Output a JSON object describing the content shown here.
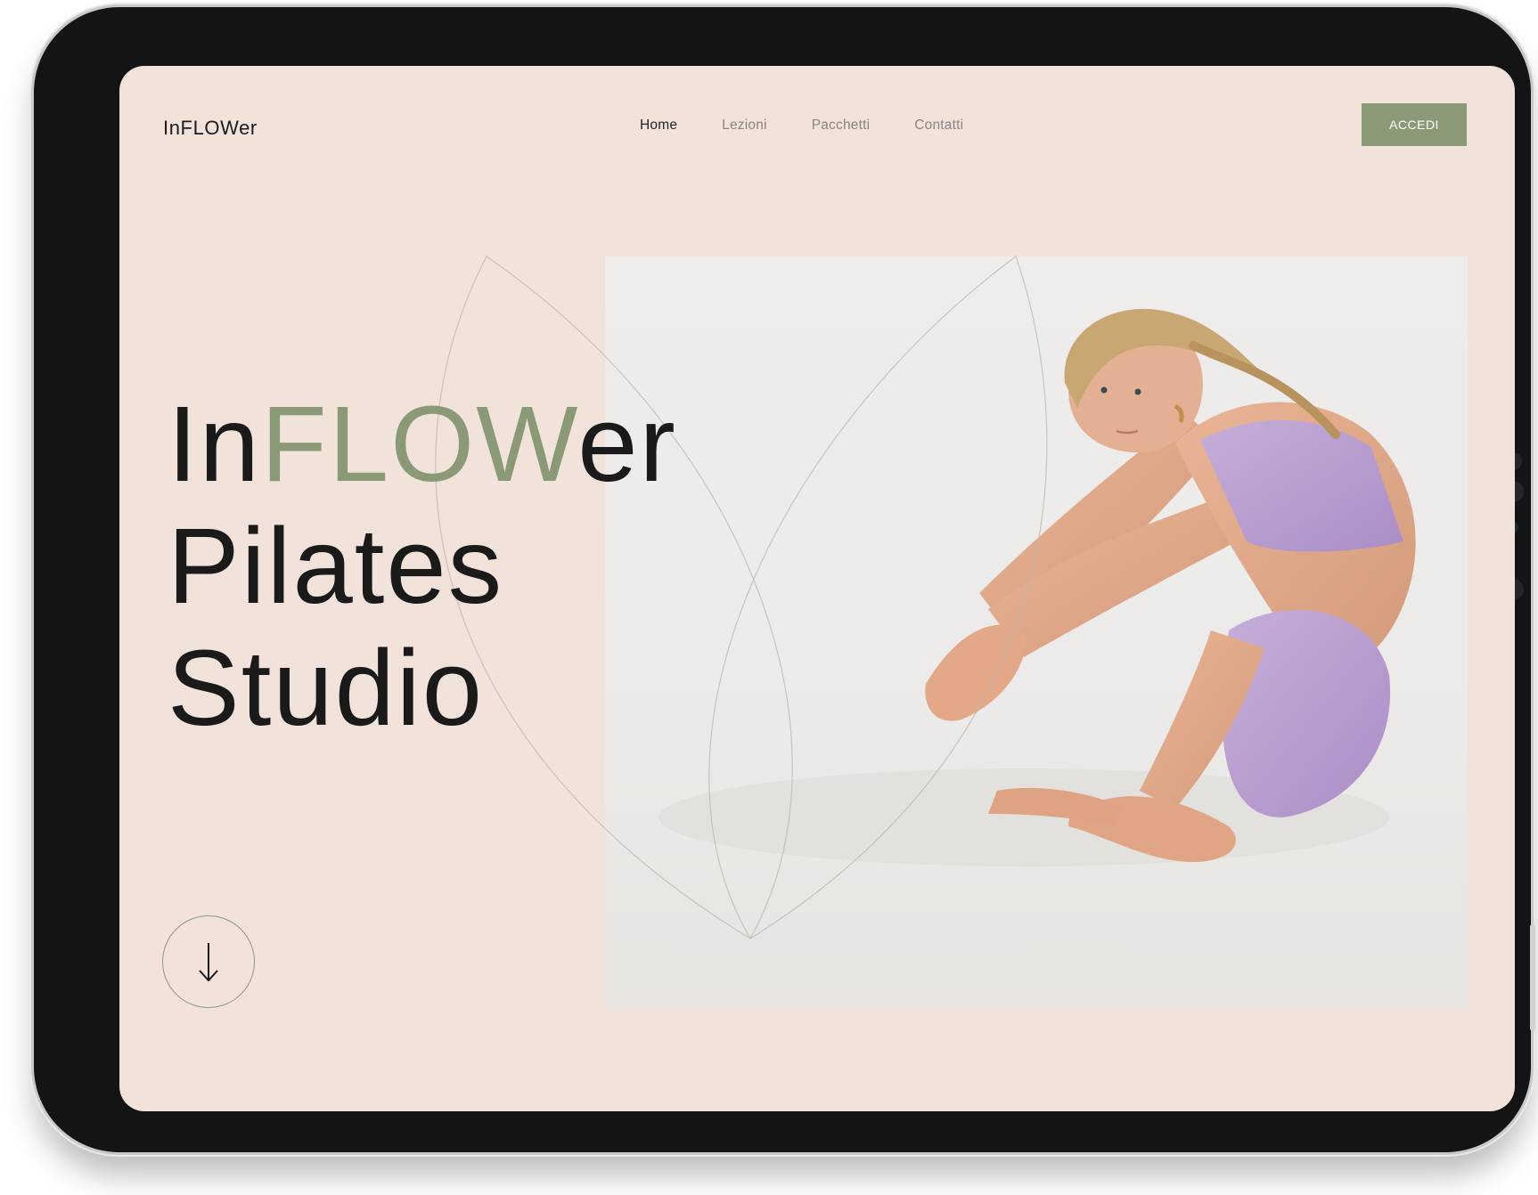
{
  "brand": "InFLOWer",
  "nav": {
    "items": [
      {
        "label": "Home",
        "active": true
      },
      {
        "label": "Lezioni",
        "active": false
      },
      {
        "label": "Pacchetti",
        "active": false
      },
      {
        "label": "Contatti",
        "active": false
      }
    ]
  },
  "cta_label": "ACCEDI",
  "hero": {
    "title_parts": [
      "In",
      "FLOW",
      "er"
    ],
    "line2": "Pilates",
    "line3": "Studio"
  },
  "scroll_icon": "arrow-down-icon",
  "hero_image": "pilates-instructor-crouching-photo",
  "colors": {
    "background": "#f2e3da",
    "accent": "#8a9a76",
    "text": "#1a1a1a",
    "nav_inactive": "#8a8580",
    "device_frame": "#141414"
  }
}
